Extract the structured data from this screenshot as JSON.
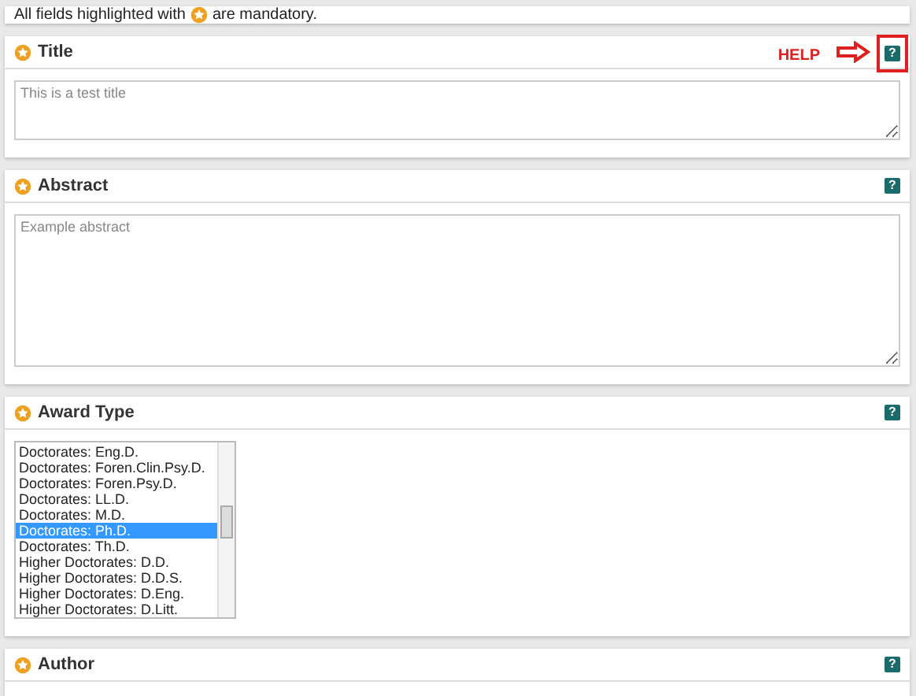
{
  "notice": {
    "before": "All fields highlighted with",
    "after": "are mandatory."
  },
  "sections": [
    {
      "kind": "short_text",
      "title": "Title",
      "mandatory": true,
      "help": "?",
      "help_highlighted": true,
      "annotation": "HELP",
      "placeholder": "This is a test title"
    },
    {
      "kind": "long_text",
      "title": "Abstract",
      "mandatory": true,
      "help": "?",
      "help_highlighted": false,
      "placeholder": "Example abstract"
    },
    {
      "kind": "list",
      "title": "Award Type",
      "mandatory": true,
      "help": "?",
      "help_highlighted": false,
      "options": [
        {
          "label": "Doctorates: Eng.D.",
          "selected": false
        },
        {
          "label": "Doctorates: Foren.Clin.Psy.D.",
          "selected": false
        },
        {
          "label": "Doctorates: Foren.Psy.D.",
          "selected": false
        },
        {
          "label": "Doctorates: LL.D.",
          "selected": false
        },
        {
          "label": "Doctorates: M.D.",
          "selected": false
        },
        {
          "label": "Doctorates: Ph.D.",
          "selected": true
        },
        {
          "label": "Doctorates: Th.D.",
          "selected": false
        },
        {
          "label": "Higher Doctorates: D.D.",
          "selected": false
        },
        {
          "label": "Higher Doctorates: D.D.S.",
          "selected": false
        },
        {
          "label": "Higher Doctorates: D.Eng.",
          "selected": false
        },
        {
          "label": "Higher Doctorates: D.Litt.",
          "selected": false
        }
      ]
    },
    {
      "kind": "header",
      "title": "Author",
      "mandatory": true,
      "help": "?",
      "help_highlighted": false
    }
  ]
}
